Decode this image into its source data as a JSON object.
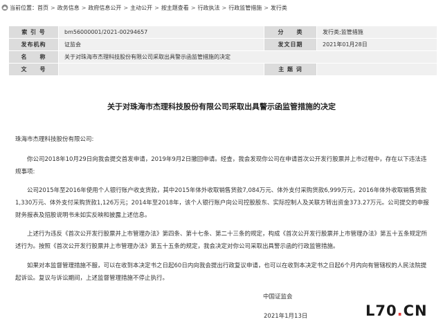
{
  "breadcrumb": {
    "prefix": "当前位置：",
    "items": [
      "首页",
      "政务信息",
      "政府信息公开",
      "主动公开",
      "按主题查看",
      "行政执法",
      "行政监管措施",
      "发行类"
    ]
  },
  "meta": {
    "index_label": "索 引 号",
    "index_value": "bm56000001/2021-00294657",
    "category_label": "分　　类",
    "category_value": "发行类;监管措施",
    "issuer_label": "发布机构",
    "issuer_value": "证监会",
    "date_label": "发文日期",
    "date_value": "2021年01月28日",
    "name_label": "名　　称",
    "name_value": "关于对珠海市杰理科技股份有限公司采取出具警示函监管措施的决定",
    "docno_label": "文　　号",
    "docno_value": "",
    "keywords_label": "主 题 词",
    "keywords_value": ""
  },
  "document": {
    "title": "关于对珠海市杰理科技股份有限公司采取出具警示函监管措施的决定",
    "salutation": "珠海市杰理科技股份有限公司:",
    "paragraphs": [
      "你公司2018年10月29日向我会提交首发申请，2019年9月2日撤回申请。经查，我会发现你公司在申请首次公开发行股票并上市过程中，存在以下违法违规事项:",
      "公司2015年至2016年使用个人银行账户收支货款，其中2015年体外收取销售货款7,084万元、体外支付采购货款6,999万元，2016年体外收取销售货款1,330万元、体外支付采购货款1,126万元；2014年至2018年，该个人银行账户向公司控股股东、实际控制人及关联方转出资金373.27万元。公司提交的申报财务报表及招股说明书未如实反映和披露上述信息。",
      "上述行为违反《首次公开发行股票并上市管理办法》第四条、第十七条、第二十三条的规定，构成《首次公开发行股票并上市管理办法》第五十五条规定所述行为。按照《首次公开发行股票并上市管理办法》第五十五条的规定，我会决定对你公司采取出具警示函的行政监管措施。",
      "如果对本监督管理措施不服，可以在收到本决定书之日起60日内向我会提出行政复议申请，也可以在收到本决定书之日起6个月内向有管辖权的人民法院提起诉讼。复议与诉讼期间，上述监督管理措施不停止执行。"
    ],
    "issuer": "中国证监会",
    "date": "2021年1月13日"
  },
  "watermark": {
    "left": "L70",
    "dot": ".",
    "right": "CN"
  },
  "colors": {
    "label_bg": "#dcdcdc",
    "value_bg": "#f0f0f0",
    "watermark_dot": "#e53e3e"
  }
}
